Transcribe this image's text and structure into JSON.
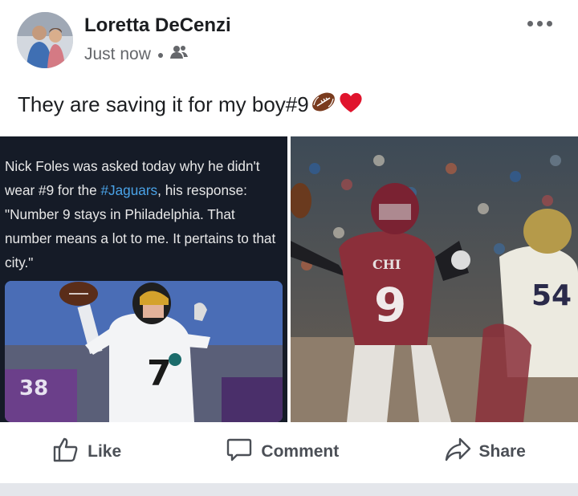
{
  "post": {
    "author": "Loretta DeCenzi",
    "timestamp": "Just now",
    "audience_icon": "friends-icon",
    "text": "They are saving it for my boy#9",
    "emojis": [
      "football-emoji",
      "red-heart-emoji"
    ]
  },
  "media": {
    "left": {
      "tweet_text_before": "Nick Foles was asked today why he didn't wear #9 for the ",
      "hashtag": "#Jaguars",
      "tweet_text_after": ", his response: \"Number 9 stays in Philadelphia. That number means a lot to me. It pertains to that city.\"",
      "player_number": "7",
      "bg_number": "38"
    },
    "right": {
      "jersey_text": "CHI",
      "player_number": "9",
      "opponent_number": "54"
    }
  },
  "actions": {
    "like": "Like",
    "comment": "Comment",
    "share": "Share"
  },
  "colors": {
    "text_primary": "#1c1e21",
    "text_secondary": "#65676b",
    "hashtag": "#4aa3e8",
    "divider": "#e4e6eb"
  }
}
